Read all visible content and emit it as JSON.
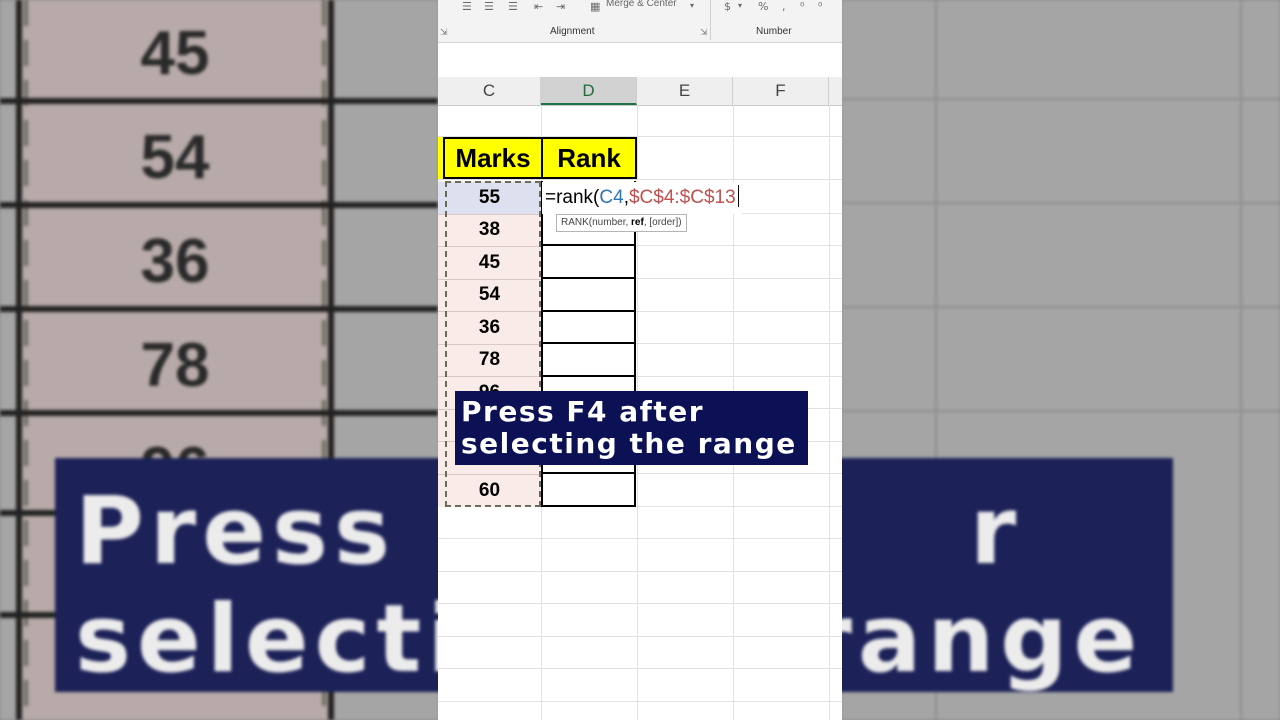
{
  "background": {
    "numbers": [
      "45",
      "54",
      "36",
      "78",
      "96"
    ],
    "banner_lines": [
      "Press F",
      "r",
      "selecti",
      "range"
    ]
  },
  "ribbon": {
    "merge_label": "Merge & Center",
    "alignment_label": "Alignment",
    "number_label": "Number",
    "currency_symbol": "$",
    "percent_symbol": "%"
  },
  "columns": [
    "C",
    "D",
    "E",
    "F"
  ],
  "active_column": "D",
  "table": {
    "headers": {
      "marks": "Marks",
      "rank": "Rank"
    },
    "marks": [
      "55",
      "38",
      "45",
      "54",
      "36",
      "78",
      "96",
      "",
      "60"
    ]
  },
  "formula": {
    "prefix": "=rank(",
    "ref_number": "C4",
    "comma": ",",
    "ref_range": "$C$4:$C$13"
  },
  "tooltip": {
    "fn": "RANK(number, ",
    "bold_arg": "ref",
    "rest": ", [order])"
  },
  "caption": {
    "line1": "Press F4 after",
    "line2": "selecting the range"
  },
  "colors": {
    "header_fill": "#ffff00",
    "caption_bg": "#0c1054",
    "active_col": "#217346",
    "ref_blue": "#2e75b6",
    "ref_red": "#c0504d"
  }
}
